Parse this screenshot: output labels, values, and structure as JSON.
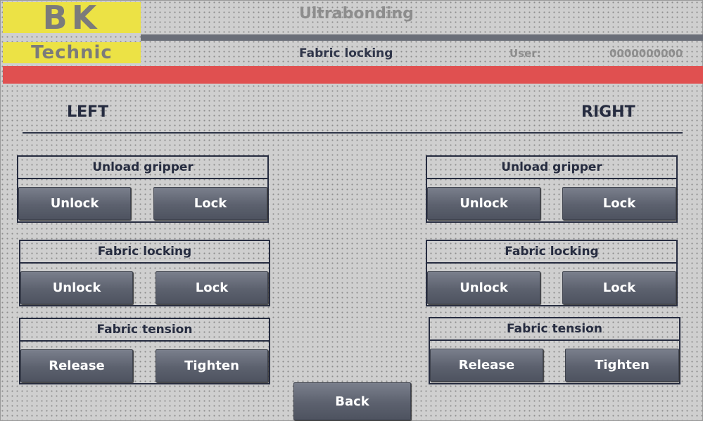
{
  "header": {
    "logo_top": "BK",
    "logo_bottom": "Technic",
    "title": "Ultrabonding",
    "subtitle": "Fabric locking",
    "user_label": "User:",
    "user_value": "0000000000"
  },
  "sides": {
    "left": "LEFT",
    "right": "RIGHT"
  },
  "groups": {
    "unload_gripper": "Unload gripper",
    "fabric_locking": "Fabric locking",
    "fabric_tension": "Fabric tension"
  },
  "buttons": {
    "unlock": "Unlock",
    "lock": "Lock",
    "release": "Release",
    "tighten": "Tighten",
    "back": "Back"
  },
  "colors": {
    "logo_yellow": "#ece245",
    "alarm_red": "#e05050",
    "button_gray": "#5c616e",
    "text_dark": "#262c40"
  }
}
